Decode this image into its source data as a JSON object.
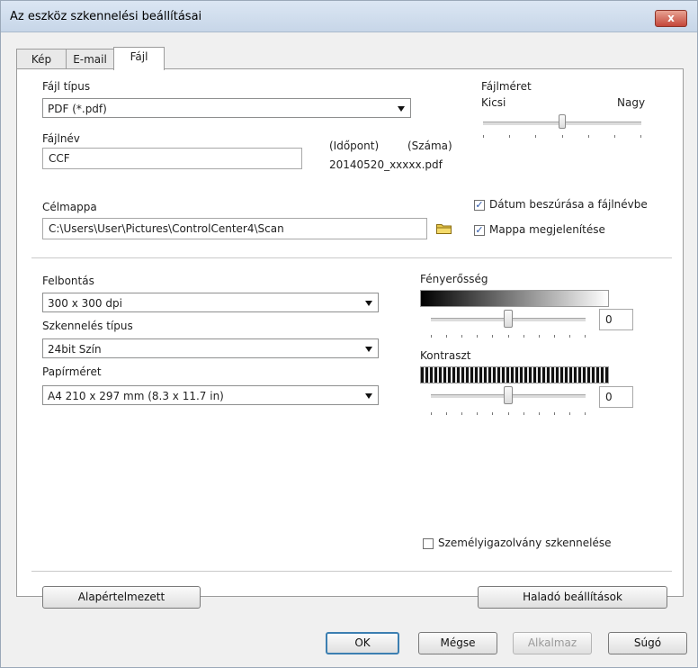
{
  "window": {
    "title": "Az eszköz szkennelési beállításai",
    "close_label": "x"
  },
  "tabs": [
    {
      "label": "Kép"
    },
    {
      "label": "E-mail"
    },
    {
      "label": "Fájl"
    }
  ],
  "file_type": {
    "label": "Fájl típus",
    "value": "PDF (*.pdf)"
  },
  "file_size": {
    "label": "Fájlméret",
    "min_label": "Kicsi",
    "max_label": "Nagy",
    "level": 0.5
  },
  "file_name": {
    "label": "Fájlnév",
    "value": "CCF",
    "date_hint": "(Időpont)",
    "number_hint": "(Száma)",
    "example": "20140520_xxxxx.pdf"
  },
  "destination": {
    "label": "Célmappa",
    "value": "C:\\Users\\User\\Pictures\\ControlCenter4\\Scan"
  },
  "checks": {
    "insert_date": {
      "label": "Dátum beszúrása a fájlnévbe",
      "checked": true
    },
    "show_folder": {
      "label": "Mappa megjelenítése",
      "checked": true
    },
    "id_card": {
      "label": "Személyigazolvány szkennelése",
      "checked": false
    }
  },
  "resolution": {
    "label": "Felbontás",
    "value": "300 x 300 dpi"
  },
  "scan_type": {
    "label": "Szkennelés típus",
    "value": "24bit Szín"
  },
  "paper_size": {
    "label": "Papírméret",
    "value": "A4 210 x 297 mm (8.3 x 11.7 in)"
  },
  "brightness": {
    "label": "Fényerősség",
    "value": "0",
    "level": 0.5
  },
  "contrast": {
    "label": "Kontraszt",
    "value": "0",
    "level": 0.5
  },
  "buttons": {
    "default": "Alapértelmezett",
    "advanced": "Haladó beállítások",
    "ok": "OK",
    "cancel": "Mégse",
    "apply": "Alkalmaz",
    "help": "Súgó"
  }
}
